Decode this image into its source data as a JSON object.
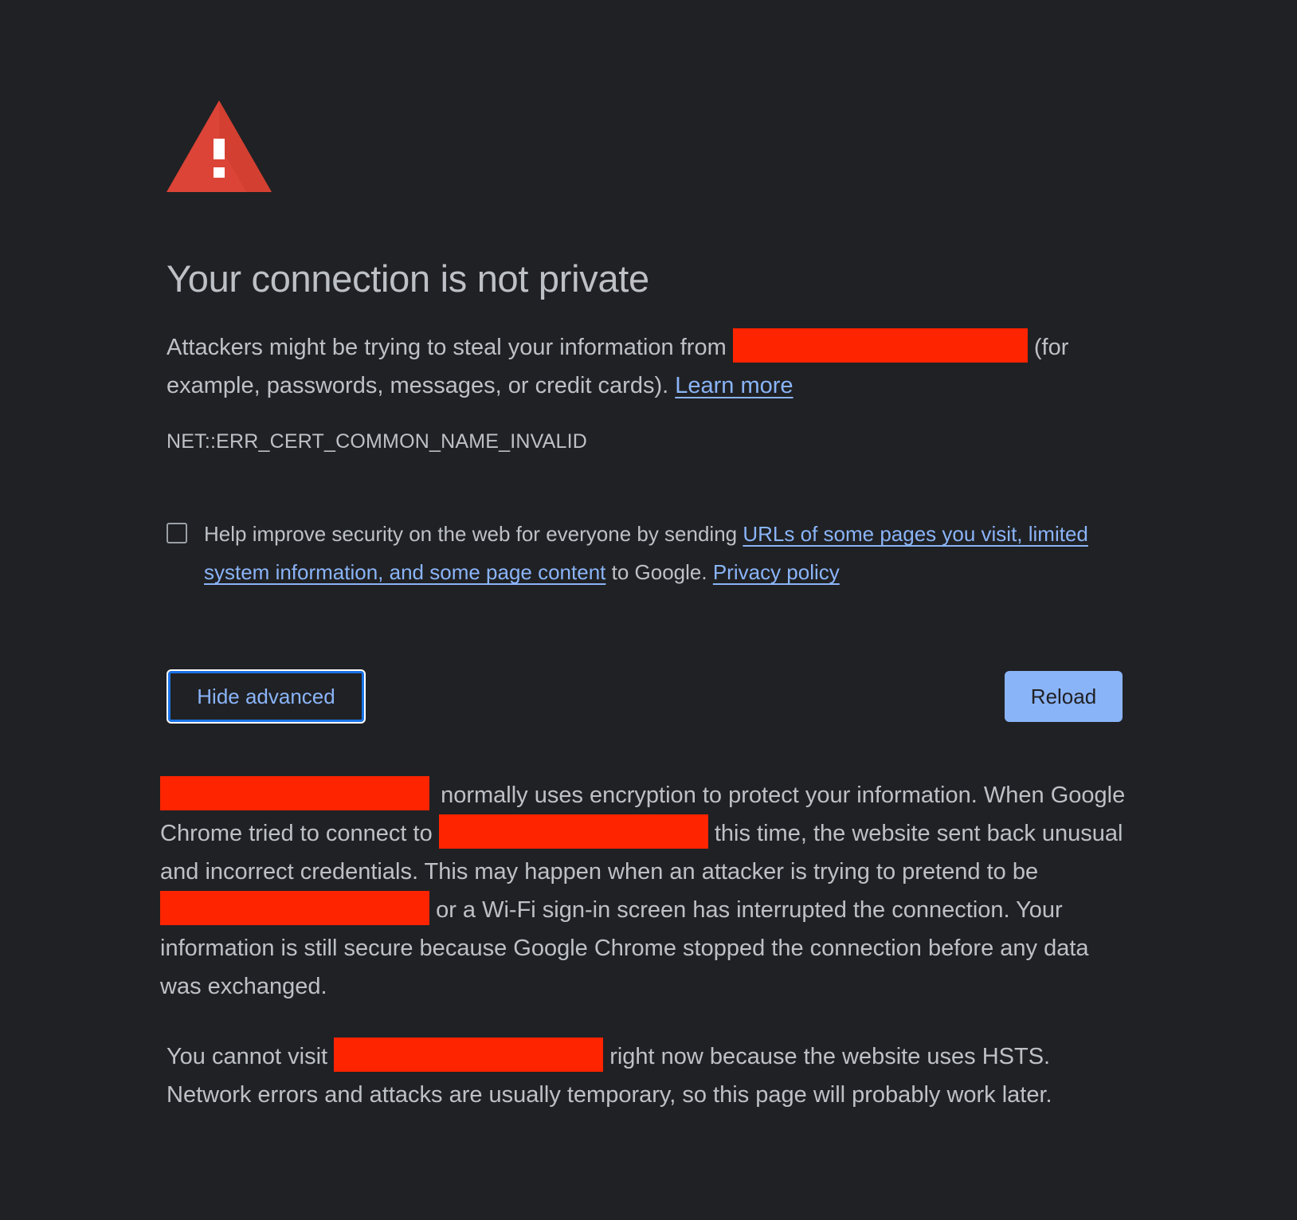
{
  "colors": {
    "background": "#202124",
    "text": "#bdc1c6",
    "link": "#8ab4f8",
    "redaction": "#ff2400",
    "warning_icon": "#db4437",
    "primary_button": "#8ab4f8"
  },
  "icon": "warning-triangle-icon",
  "title": "Your connection is not private",
  "intro": {
    "before_site": "Attackers might be trying to steal your information from",
    "after_site": "(for example, passwords, messages, or credit cards).",
    "learn_more": "Learn more"
  },
  "error_code": "NET::ERR_CERT_COMMON_NAME_INVALID",
  "opt_in": {
    "checked": false,
    "before_link": "Help improve security on the web for everyone by sending",
    "link1": "URLs of some pages you visit, limited system information, and some page content",
    "middle": "to Google.",
    "link2": "Privacy policy"
  },
  "buttons": {
    "hide_advanced": "Hide advanced",
    "reload": "Reload"
  },
  "details": {
    "p1_after_site1": "normally uses encryption to protect your information. When Google Chrome tried to connect to",
    "p1_after_site2": "this time, the website sent back unusual and incorrect credentials. This may happen when an attacker is trying to pretend to be",
    "p1_after_site3": "or a Wi-Fi sign-in screen has interrupted the connection. Your information is still secure because Google Chrome stopped the connection before any data was exchanged.",
    "p2_before_site": "You cannot visit",
    "p2_after_site": "right now because the website uses HSTS. Network errors and attacks are usually temporary, so this page will probably work later."
  }
}
